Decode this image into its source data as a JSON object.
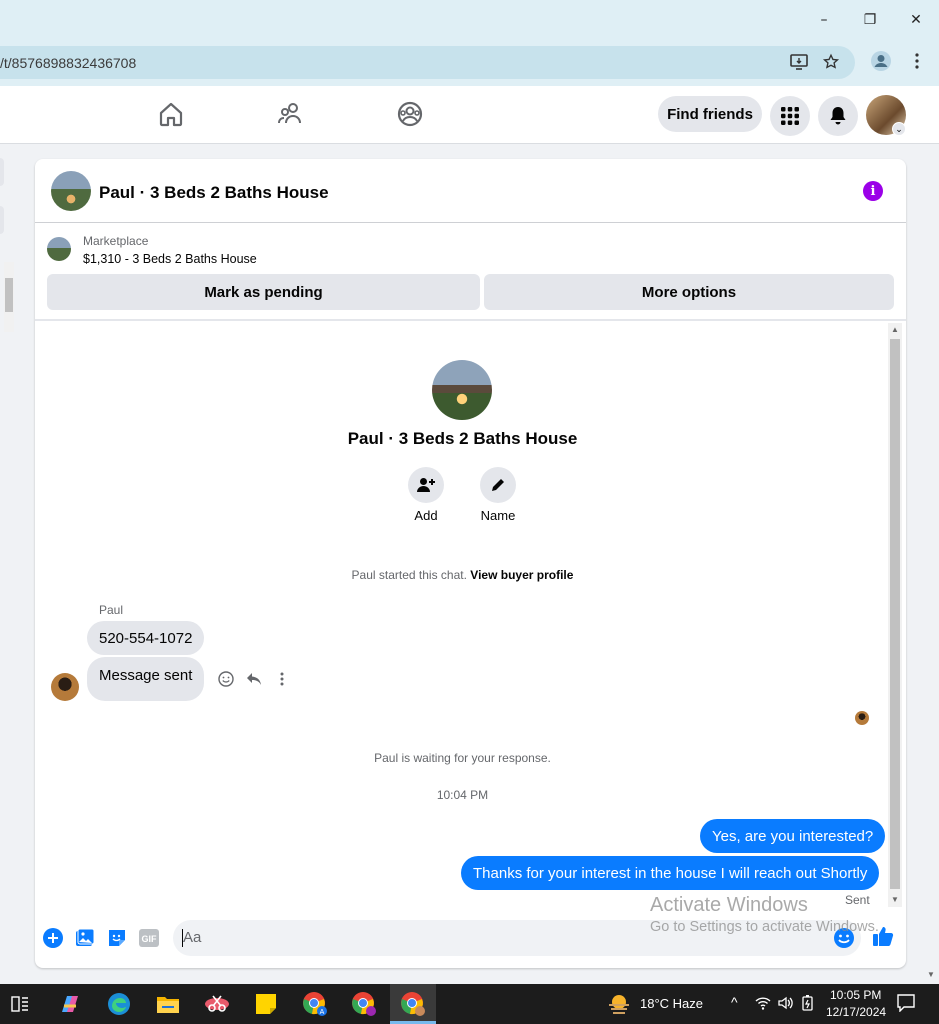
{
  "browser": {
    "url": "/t/8576898832436708",
    "minimize": "–",
    "restore": "❐",
    "close": "✕"
  },
  "nav": {
    "find_friends": "Find friends"
  },
  "thread": {
    "title": "Paul · 3 Beds 2 Baths House",
    "marketplace_label": "Marketplace",
    "listing": "$1,310 - 3 Beds 2 Baths House",
    "mark_pending": "Mark as pending",
    "more_options": "More options"
  },
  "profile": {
    "name": "Paul · 3 Beds 2 Baths House",
    "add_label": "Add",
    "name_label": "Name"
  },
  "messages": {
    "started_text": "Paul started this chat.",
    "view_profile": "View buyer profile",
    "sender": "Paul",
    "incoming": [
      "520-554-1072",
      "Message sent"
    ],
    "waiting": "Paul is waiting for your response.",
    "timestamp": "10:04 PM",
    "outgoing": [
      "Yes, are you interested?",
      "Thanks for your interest in the house I will reach out Shortly"
    ],
    "status": "Sent"
  },
  "composer": {
    "placeholder": "Aa"
  },
  "watermark": {
    "line1": "Activate Windows",
    "line2": "Go to Settings to activate Windows."
  },
  "taskbar": {
    "weather": "18°C  Haze",
    "time": "10:05 PM",
    "date": "12/17/2024"
  },
  "colors": {
    "accent": "#0a7cff",
    "info": "#9b00e8"
  }
}
